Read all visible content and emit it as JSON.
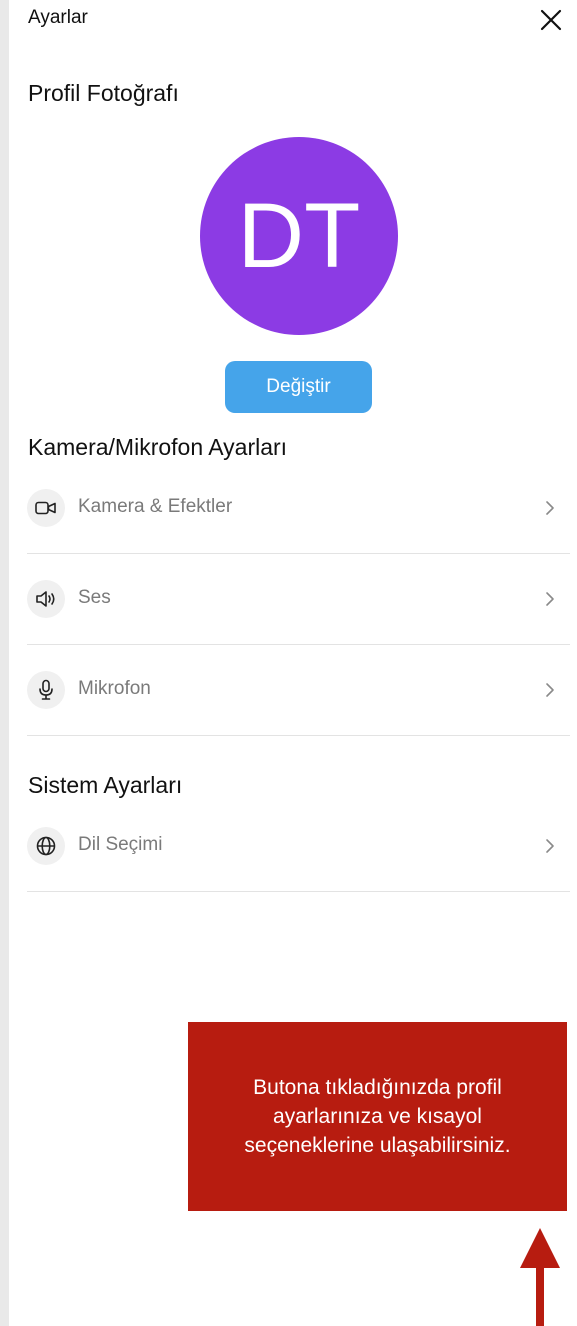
{
  "header": {
    "title": "Ayarlar"
  },
  "profile": {
    "section_title": "Profil Fotoğrafı",
    "avatar_initials": "DT",
    "avatar_color": "#8c3be4",
    "change_label": "Değiştir"
  },
  "camera_mic": {
    "section_title": "Kamera/Mikrofon Ayarları",
    "items": [
      {
        "label": "Kamera & Efektler",
        "icon": "video-camera-icon"
      },
      {
        "label": "Ses",
        "icon": "speaker-icon"
      },
      {
        "label": "Mikrofon",
        "icon": "microphone-icon"
      }
    ]
  },
  "system": {
    "section_title": "Sistem Ayarları",
    "items": [
      {
        "label": "Dil Seçimi",
        "icon": "globe-icon"
      }
    ]
  },
  "callout": {
    "text": "Butona tıkladığınızda profil ayarlarınıza ve kısayol seçeneklerine ulaşabilirsiniz.",
    "color": "#b71c10"
  }
}
